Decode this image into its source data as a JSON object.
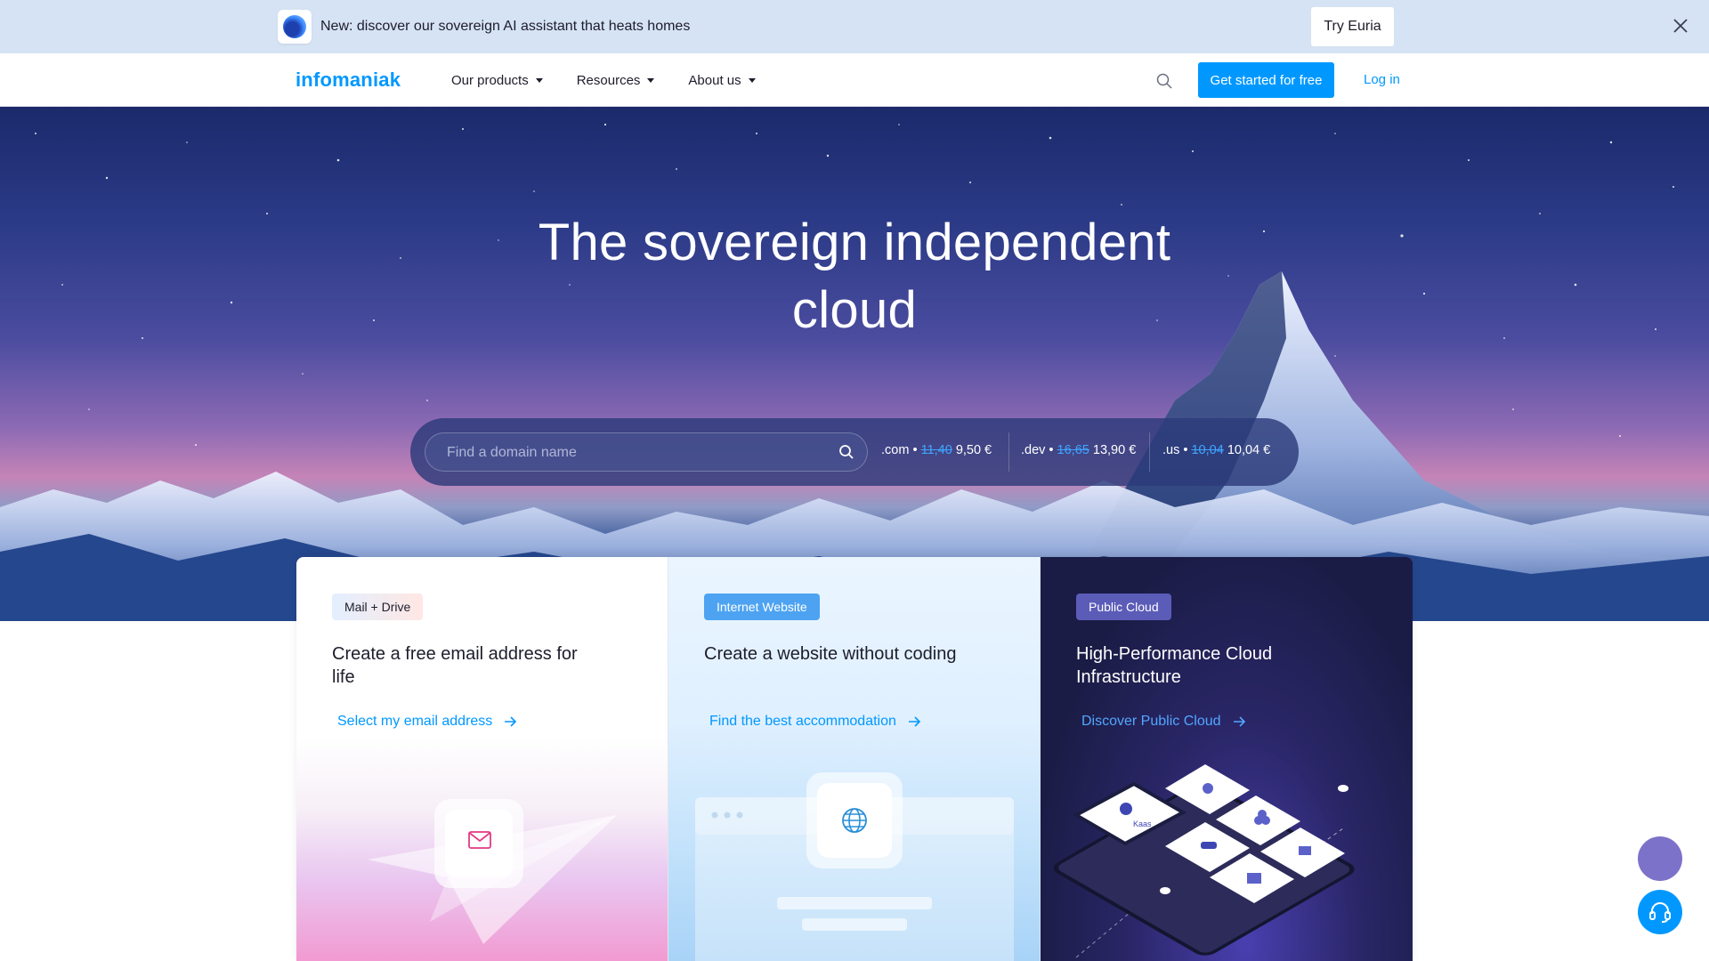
{
  "announcement": {
    "text": "New: discover our sovereign AI assistant that heats homes",
    "cta": "Try Euria",
    "badge_icon": "euria-logo-icon",
    "close_icon": "close-icon"
  },
  "nav": {
    "logo": "infomaniak",
    "menu": [
      {
        "label": "Our products"
      },
      {
        "label": "Resources"
      },
      {
        "label": "About us"
      }
    ],
    "search_icon": "search-icon",
    "cta": "Get started for free",
    "login": "Log in"
  },
  "hero": {
    "title": "The sovereign independent cloud",
    "search": {
      "placeholder": "Find a domain name",
      "icon": "search-icon"
    },
    "tlds": [
      {
        "ext": ".com •",
        "old_price": "11,40",
        "price": "9,50 €"
      },
      {
        "ext": ".dev •",
        "old_price": "16,65",
        "price": "13,90 €"
      },
      {
        "ext": ".us •",
        "old_price": "10,04",
        "price": "10,04 €"
      }
    ]
  },
  "cards": [
    {
      "tag": "Mail + Drive",
      "title": "Create a free email address for life",
      "link": "Select my email address",
      "icon": "envelope-icon"
    },
    {
      "tag": "Internet Website",
      "title": "Create a website without coding",
      "link": "Find the best accommodation",
      "icon": "globe-icon"
    },
    {
      "tag": "Public Cloud",
      "title": "High-Performance Cloud Infrastructure",
      "link": "Discover Public Cloud",
      "icon": "cloud-infrastructure-icon",
      "illustration_text": "Kaas"
    }
  ],
  "floating": {
    "chat_icon": "assistant-icon",
    "support_icon": "headset-icon"
  },
  "colors": {
    "brand": "#0098ff",
    "announcement_bg": "#d6e3f4",
    "hero_dark": "#1b2a6b"
  }
}
